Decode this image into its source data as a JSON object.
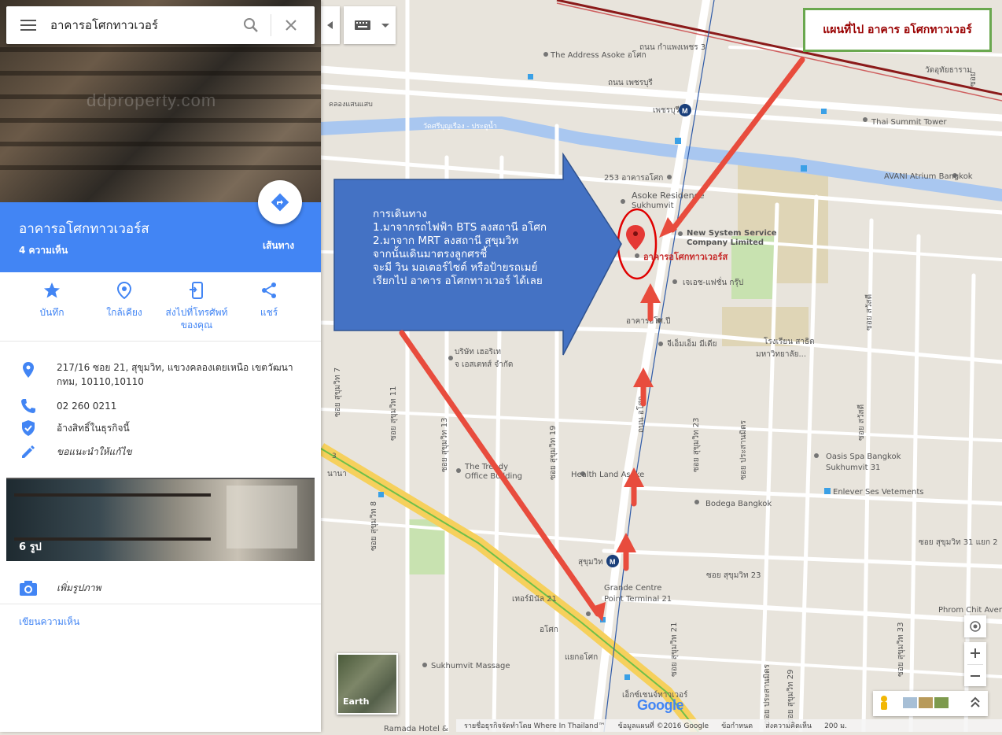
{
  "search": {
    "value": "อาคารอโศกทาวเวอร์"
  },
  "place": {
    "title": "อาคารอโศกทาวเวอร์ส",
    "reviews": "4 ความเห็น",
    "directions_label": "เส้นทาง",
    "hero_watermark": "ddproperty.com"
  },
  "actions": [
    {
      "label": "บันทึก",
      "icon": "star-icon"
    },
    {
      "label": "ใกล้เคียง",
      "icon": "nearby-icon"
    },
    {
      "label": "ส่งไปที่โทรศัพท์ของคุณ",
      "icon": "send-to-phone-icon"
    },
    {
      "label": "แชร์",
      "icon": "share-icon"
    }
  ],
  "info": {
    "address": "217/16 ซอย 21, สุขุมวิท, แขวงคลองเตยเหนือ เขตวัฒนา กทม, 10110,10110",
    "phone": "02 260 0211",
    "claim": "อ้างสิทธิ์ในธุรกิจนี้",
    "suggest": "ขอแนะนำให้แก้ไข"
  },
  "photos": {
    "count": "6 รูป"
  },
  "add_photo": "เพิ่มรูปภาพ",
  "write_review": "เขียนความเห็น",
  "callout": "แผนที่ไป อาคาร อโศกทาวเวอร์",
  "instructions": [
    "การเดินทาง",
    "1.มาจากรถไฟฟ้า BTS ลงสถานี อโศก",
    "2.มาจาก MRT ลงสถานี สุขุมวิท",
    "จากนั้นเดินมาตรงลูกศรชี้",
    "จะมี วิน มอเตอร์ไซต์ หรือป้ายรถเมย์",
    "เรียกไป อาคาร อโศกทาวเวอร์ ได้เลย"
  ],
  "map_labels": {
    "address_asoke": "The Address Asoke อโศก",
    "petchaburi_road": "ถนน เพชรบุรี",
    "kamphaeng_road": "ถนน กำแพงเพชร 3",
    "petchaburi_mrt": "เพชรบุรี",
    "thai_summit": "Thai Summit Tower",
    "wat_canal": "วัดศรีบุญเรือง - ประตูน้ำ",
    "avani": "AVANI Atrium Bangkok",
    "asoke_253": "253 อาคารอโศก",
    "asoke_residence": "Asoke Residence",
    "sukhumvit_small": "Sukhumvit",
    "new_system_1": "New System Service",
    "new_system_2": "Company Limited",
    "asoke_tower": "อาคารอโศกทาวเวอร์ส",
    "jes_fashion": "เจเอช-แฟชั่น กรุ๊ป",
    "asoke_building": "อาคารอโศ.ปี",
    "gmm": "จีเอ็มเอ็ม มีเดีย",
    "school_1": "โรงเรียน สาธิต",
    "school_2": "มหาวิทยาลัย...",
    "wattana": "วัฒนาสวีท",
    "company_1": "บริษัท เฮอริเท",
    "company_2": "จ เอสเตทส์ จำกัด",
    "trendy_1": "The Trendy",
    "trendy_2": "Office Building",
    "health_land": "Health Land Asoke",
    "oasis_1": "Oasis Spa Bangkok",
    "oasis_2": "Sukhumvit 31",
    "enlever": "Enlever Ses Vetements",
    "bodega": "Bodega Bangkok",
    "sukhumvit_mrt": "สุขุมวิท",
    "grande_1": "Grande Centre",
    "grande_2": "Point Terminal 21",
    "terminal21": "เทอร์มินัล 21",
    "asok_bts": "อโศก",
    "asok_junction": "แยกอโศก",
    "sukhumvit_massage": "Sukhumvit Massage",
    "exchange_tower": "เอ็กซ์เชนจ์ทาวเวอร์",
    "ramada": "Ramada Hotel &",
    "nana": "นานา",
    "phrom_chit": "Phrom Chit Avenue",
    "sukhumvit_31_2": "ซอย สุขุมวิท 31 แยก 2",
    "sukhumvit_23": "ซอย สุขุมวิท 23",
    "sukhumvit_23_v": "ซอย สุขุมวิท 23",
    "sukhumvit_19": "ซอย สุขุมวิท 19",
    "sukhumvit_13": "ซอย สุขุมวิท 13",
    "sukhumvit_11": "ซอย สุขุมวิท 11",
    "sukhumvit_8": "ซอย สุขุมวิท 8",
    "sukhumvit_7": "ซอย สุขุมวิท 7",
    "sukhumvit_21": "ซอย สุขุมวิท 21",
    "sukhumvit_33": "ซอย สุขุมวิท 33",
    "sukhumvit_29": "ซอย สุขุมวิท 29",
    "prasanmitr": "ซอย ประสานมิตร",
    "prasanmitr_2": "ซอย ประสานมิตร",
    "sukhumvit_road": "สุขุมวิท",
    "asok_road": "ถนน อโศก",
    "wat_tha": "วัดอุทัยธาราม",
    "khlong": "คลองแสนแสบ",
    "sawasdee": "ซอย สวัสดี",
    "sawasdee_2": "ซอย สวัสดี",
    "soi": "ซอย",
    "route_3": "3"
  },
  "earth_label": "Earth",
  "google_logo": "Google",
  "footer": [
    "รายชื่อธุรกิจจัดทำโดย Where In Thailand™",
    "ข้อมูลแผนที่ ©2016 Google",
    "ข้อกำหนด",
    "ส่งความคิดเห็น",
    "200 ม."
  ],
  "colors": {
    "accent_blue": "#4285f4",
    "arrow_red": "#e84c3d",
    "callout_border": "#6aa84f",
    "callout_text": "#990000",
    "instruction_arrow": "#4472c4"
  }
}
